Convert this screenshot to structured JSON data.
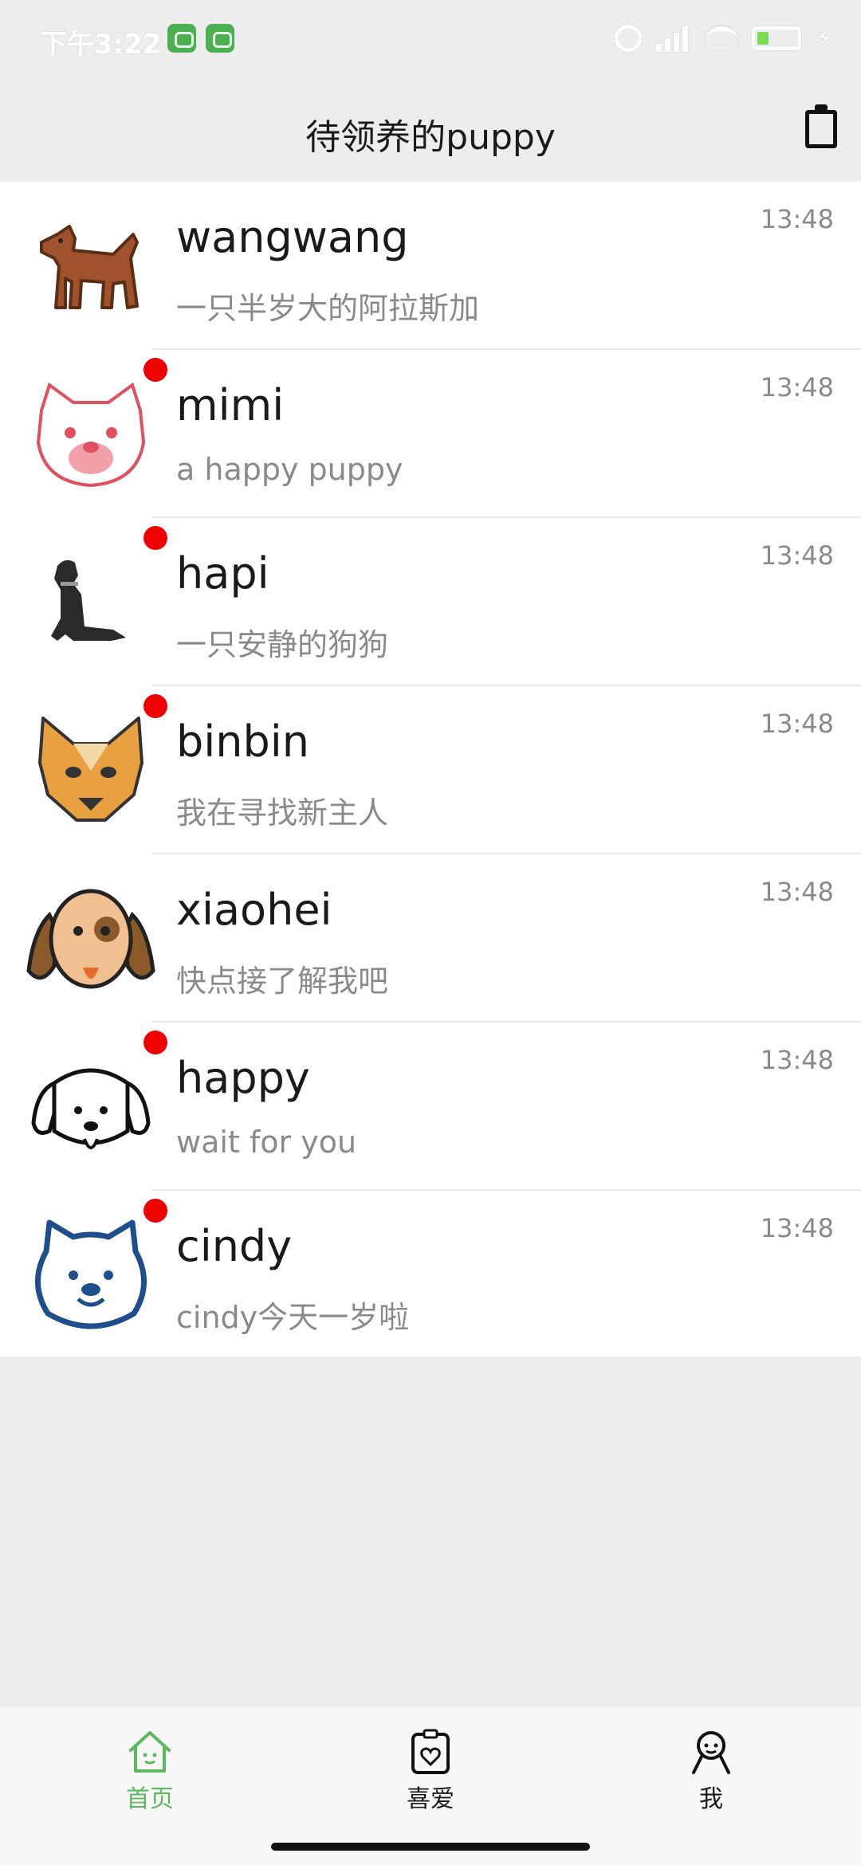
{
  "status_bar": {
    "time": "下午3:22",
    "battery_color": "#7ed957"
  },
  "header": {
    "title": "待领养的puppy",
    "action_icon": "clipboard-icon"
  },
  "puppies": [
    {
      "name": "wangwang",
      "message": "一只半岁大的阿拉斯加",
      "time": "13:48",
      "unread": false,
      "avatar": "brown-dog-icon"
    },
    {
      "name": "mimi",
      "message": "a happy puppy",
      "time": "13:48",
      "unread": true,
      "avatar": "shiba-face-icon"
    },
    {
      "name": "hapi",
      "message": "一只安静的狗狗",
      "time": "13:48",
      "unread": true,
      "avatar": "sitting-dog-icon"
    },
    {
      "name": "binbin",
      "message": "我在寻找新主人",
      "time": "13:48",
      "unread": true,
      "avatar": "husky-face-icon"
    },
    {
      "name": "xiaohei",
      "message": "快点接了解我吧",
      "time": "13:48",
      "unread": false,
      "avatar": "spotted-dog-face-icon"
    },
    {
      "name": "happy",
      "message": "wait for you",
      "time": "13:48",
      "unread": true,
      "avatar": "outline-dog-face-icon"
    },
    {
      "name": "cindy",
      "message": "cindy今天一岁啦",
      "time": "13:48",
      "unread": true,
      "avatar": "blue-bear-face-icon"
    }
  ],
  "tabs": [
    {
      "label": "首页",
      "icon": "home-icon",
      "active": true
    },
    {
      "label": "喜爱",
      "icon": "heart-clipboard-icon",
      "active": false
    },
    {
      "label": "我",
      "icon": "person-icon",
      "active": false
    }
  ],
  "colors": {
    "accent": "#5cb85c",
    "unread_dot": "#f00000",
    "background": "#ededed"
  }
}
